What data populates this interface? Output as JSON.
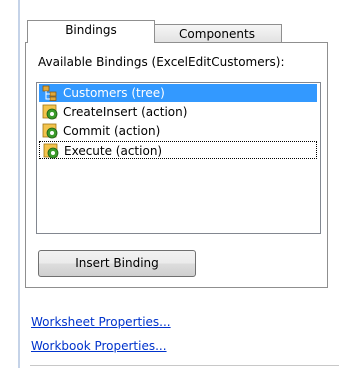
{
  "tabs": [
    {
      "label": "Bindings",
      "active": true
    },
    {
      "label": "Components",
      "active": false
    }
  ],
  "caption": "Available Bindings (ExcelEditCustomers):",
  "bindings": [
    {
      "label": "Customers (tree)",
      "icon": "tree-binding-icon",
      "selected": true
    },
    {
      "label": "CreateInsert (action)",
      "icon": "action-binding-icon",
      "selected": false
    },
    {
      "label": "Commit (action)",
      "icon": "action-binding-icon",
      "selected": false
    },
    {
      "label": "Execute (action)",
      "icon": "action-binding-icon",
      "selected": false,
      "focused": true
    }
  ],
  "insert_button_label": "Insert Binding",
  "links": {
    "worksheet": "Worksheet Properties...",
    "workbook": "Workbook Properties..."
  },
  "colors": {
    "selection": "#3399ff",
    "link": "#0033cc",
    "action_icon": "#3c9b2a",
    "tree_icon": "#e0a83a"
  }
}
